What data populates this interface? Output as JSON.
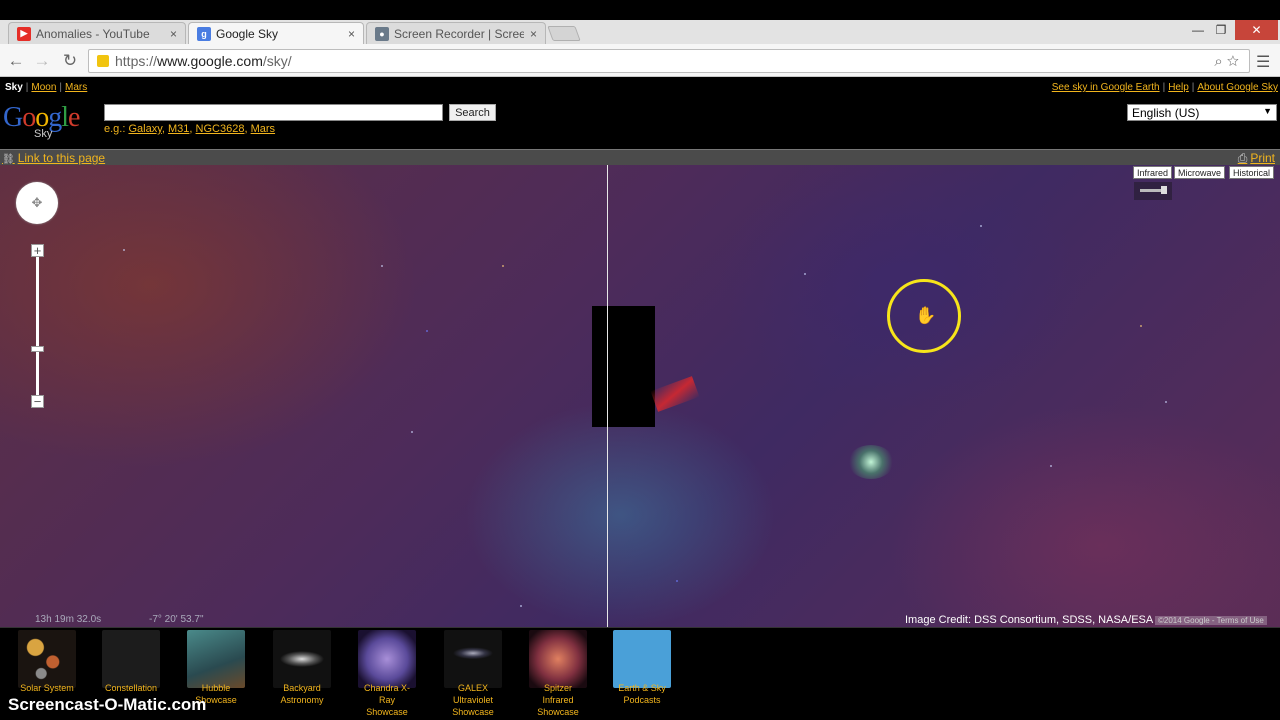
{
  "browser": {
    "tabs": [
      {
        "label": "Anomalies - YouTube",
        "close": "×"
      },
      {
        "label": "Google Sky",
        "close": "×"
      },
      {
        "label": "Screen Recorder | Screenc",
        "close": "×"
      }
    ],
    "url_prefix": "https://",
    "url_host": "www.google.com",
    "url_path": "/sky/",
    "window_controls": {
      "minimize": "—",
      "restore": "❐",
      "close": "✕"
    }
  },
  "sky_header": {
    "nav": {
      "current": "Sky",
      "moon": "Moon",
      "mars": "Mars"
    },
    "right_links": [
      "See sky in Google Earth",
      "Help",
      "About Google Sky"
    ],
    "logo_text": "Google",
    "logo_sub": "Sky",
    "search_value": "",
    "search_button": "Search",
    "examples_prefix": "e.g.:",
    "examples": [
      "Galaxy",
      "M31",
      "NGC3628",
      "Mars"
    ],
    "language": "English (US)"
  },
  "link_bar": {
    "link_to_page": "Link to this page",
    "print": "Print"
  },
  "map": {
    "layers": [
      "Infrared",
      "Microwave",
      "Historical"
    ],
    "coord_ra": "13h 19m 32.0s",
    "coord_dec": "-7° 20' 53.7\"",
    "image_credit": "Image Credit: DSS Consortium, SDSS, NASA/ESA",
    "copyright": "©2014 Google - Terms of Use",
    "zoom_in": "+",
    "zoom_out": "−"
  },
  "showcases": [
    {
      "label": "Solar System",
      "color": "#3a2a1a"
    },
    {
      "label": "Constellation",
      "color": "#1c1c1c"
    },
    {
      "label": "Hubble Showcase",
      "color": "#3a6d70"
    },
    {
      "label": "Backyard Astronomy",
      "color": "#1a1a1a"
    },
    {
      "label": "Chandra X-Ray Showcase",
      "color": "#4b3f7a"
    },
    {
      "label": "GALEX Ultraviolet Showcase",
      "color": "#141418"
    },
    {
      "label": "Spitzer Infrared Showcase",
      "color": "#2a1a1a"
    },
    {
      "label": "Earth & Sky Podcasts",
      "color": "#4aa0d8"
    }
  ],
  "watermark": "Screencast-O-Matic.com",
  "colors": {
    "link": "#f2b51d",
    "cursor_ring": "#f7e51a"
  }
}
